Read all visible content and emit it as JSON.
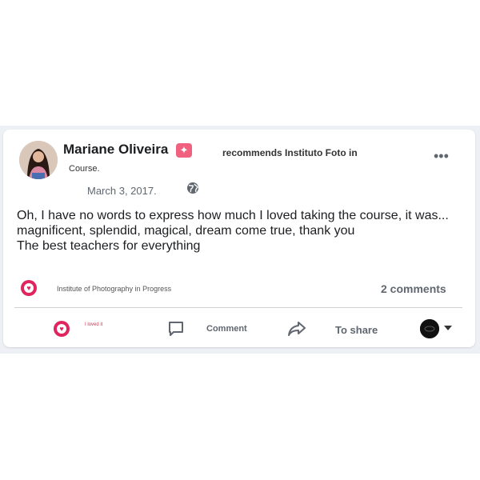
{
  "post": {
    "author_name": "Mariane Oliveira",
    "recommends_text": "recommends Instituto Foto in",
    "course_text": "Course.",
    "date": "March 3, 2017.",
    "body_lines": [
      "Oh, I have no words to express how much I loved taking the course, it was...",
      "magnificent, splendid, magical, dream come true, thank you",
      "The best teachers for everything"
    ],
    "reactions": {
      "icon": "heart-icon",
      "names": "Institute of Photography in Progress",
      "comments": "2 comments"
    },
    "actions": {
      "love_label": "I loved it",
      "comment_label": "Comment",
      "share_label": "To share"
    },
    "icons": {
      "badge": "star-badge-icon",
      "more": "more-options-icon",
      "privacy": "globe-icon",
      "comment": "comment-bubble-icon",
      "share": "share-arrow-icon",
      "audience_caret": "chevron-down-icon"
    },
    "colors": {
      "love": "#e0245e",
      "badge": "#f0607f",
      "muted_text": "#606770",
      "background_band": "#edf0f5"
    }
  }
}
